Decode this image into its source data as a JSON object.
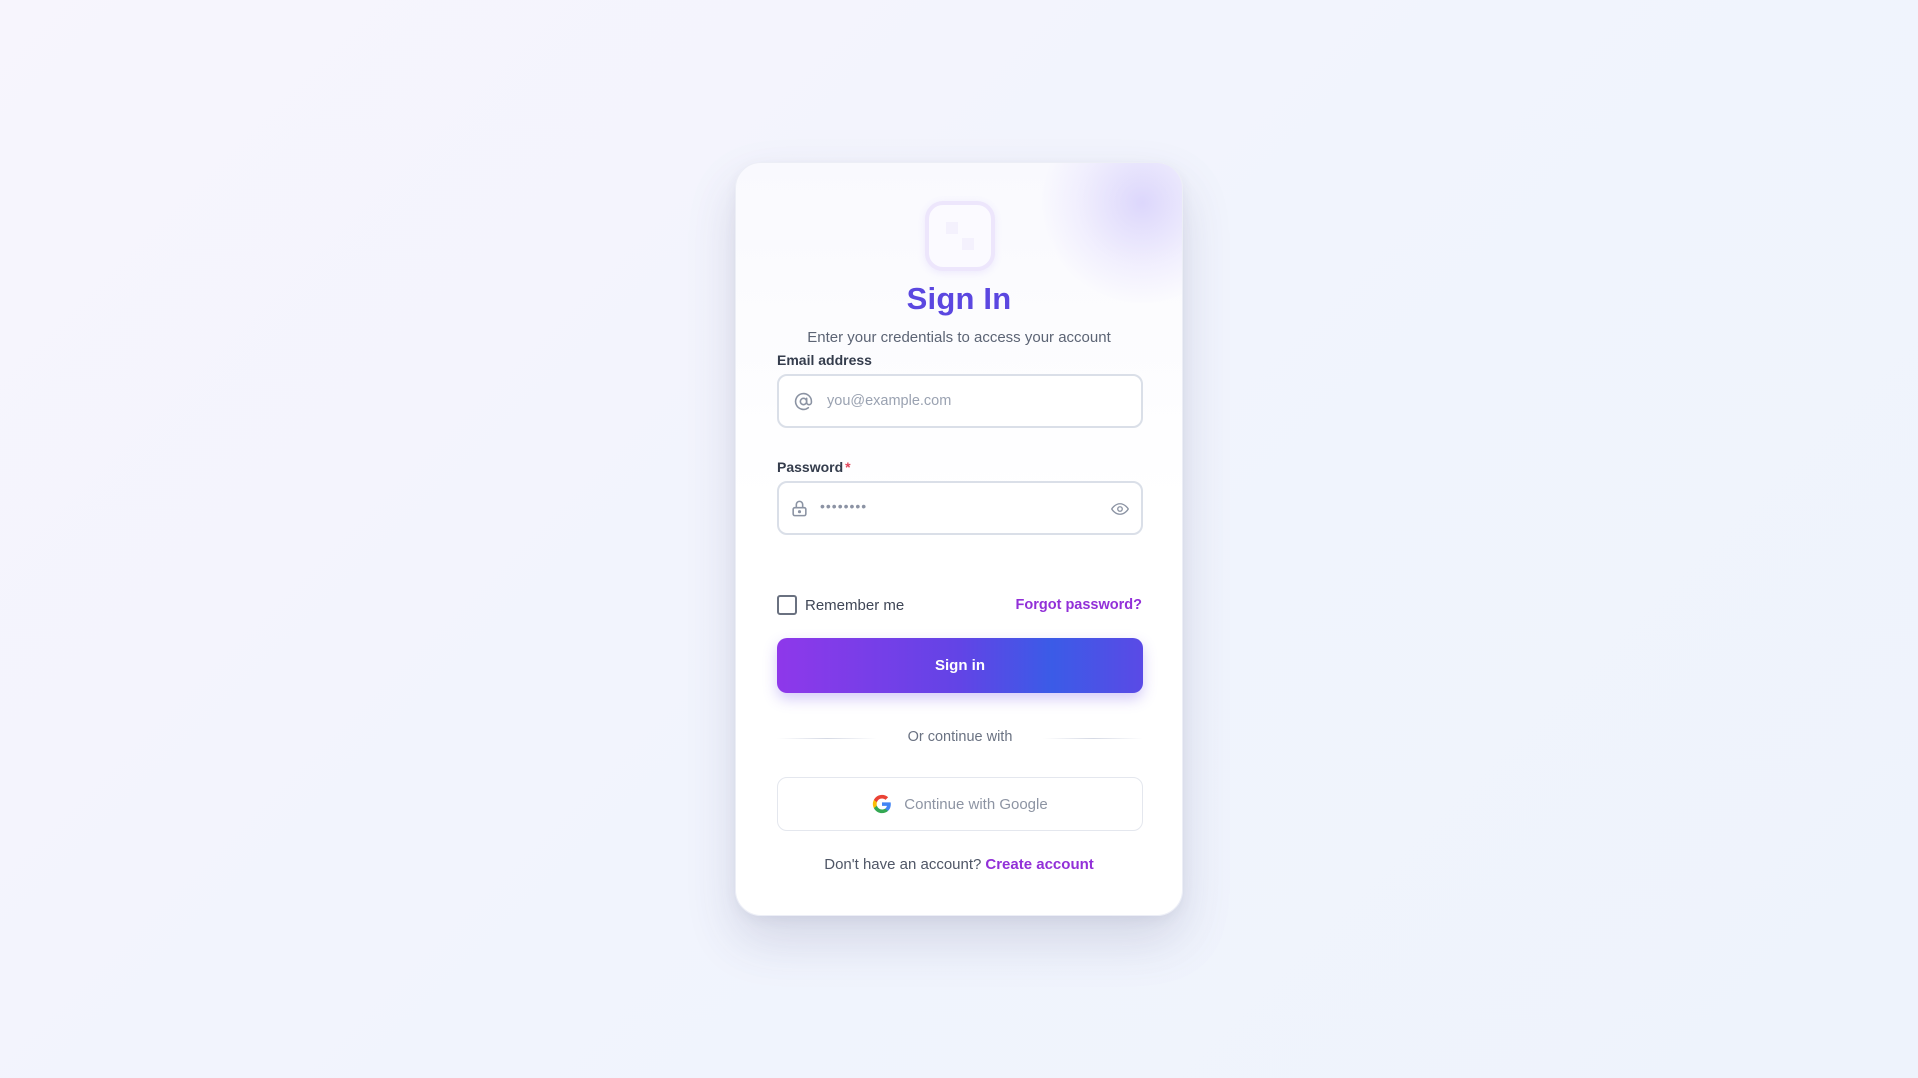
{
  "header": {
    "title": "Sign In",
    "subtitle": "Enter your credentials to access your account"
  },
  "email": {
    "label": "Email address",
    "placeholder": "you@example.com",
    "value": ""
  },
  "password": {
    "label": "Password",
    "required_mark": "*",
    "masked_value": "••••••••"
  },
  "options": {
    "remember_label": "Remember me",
    "remember_checked": false,
    "forgot_label": "Forgot password?"
  },
  "actions": {
    "signin_label": "Sign in",
    "divider_text": "Or continue with",
    "google_label": "Continue with Google"
  },
  "footer": {
    "prompt": "Don't have an account?",
    "link": "Create account"
  },
  "icons": {
    "email": "at-icon",
    "password": "lock-icon",
    "toggle": "eye-icon",
    "google": "google-icon"
  },
  "colors": {
    "accent": "#5b47e0",
    "link": "#9230d8",
    "button_start": "#8e38ea",
    "button_end": "#3b5be7",
    "required": "#e0445a"
  }
}
